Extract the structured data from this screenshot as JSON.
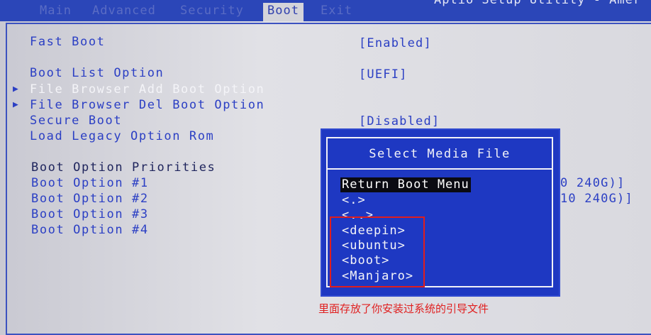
{
  "tabs": [
    {
      "label": "Main",
      "active": false
    },
    {
      "label": "Advanced",
      "active": false
    },
    {
      "label": "Security",
      "active": false
    },
    {
      "label": "Boot",
      "active": true
    },
    {
      "label": "Exit",
      "active": false
    }
  ],
  "header_title": "Aptio Setup Utility - Amer",
  "settings": [
    {
      "label": "Fast Boot",
      "value": "[Enabled]"
    },
    {
      "label": "Boot List Option",
      "value": "[UEFI]"
    },
    {
      "label": "File Browser Add Boot Option",
      "value": "",
      "submenu": true
    },
    {
      "label": "File Browser Del Boot Option",
      "value": "",
      "submenu": true
    },
    {
      "label": "Secure Boot",
      "value": "[Disabled]"
    },
    {
      "label": "Load Legacy Option Rom",
      "value": ""
    },
    {
      "label": "Boot Option Priorities",
      "value": "",
      "heading": true
    },
    {
      "label": "Boot Option #1",
      "value": "0 240G)]"
    },
    {
      "label": "Boot Option #2",
      "value": "10 240G)]"
    },
    {
      "label": "Boot Option #3",
      "value": ""
    },
    {
      "label": "Boot Option #4",
      "value": ""
    }
  ],
  "dialog": {
    "title": "Select Media File",
    "items": [
      {
        "label": "Return Boot Menu",
        "selected": true
      },
      {
        "label": "<.>",
        "selected": false
      },
      {
        "label": "<..>",
        "selected": false
      },
      {
        "label": "<deepin>",
        "selected": false
      },
      {
        "label": "<ubuntu>",
        "selected": false
      },
      {
        "label": "<boot>",
        "selected": false
      },
      {
        "label": "<Manjaro>",
        "selected": false
      }
    ]
  },
  "annotation": "里面存放了你安装过系统的引导文件",
  "colors": {
    "bios_blue": "#2b3fc4",
    "dialog_bg": "#1e38c2",
    "annotation_red": "#e02020"
  }
}
